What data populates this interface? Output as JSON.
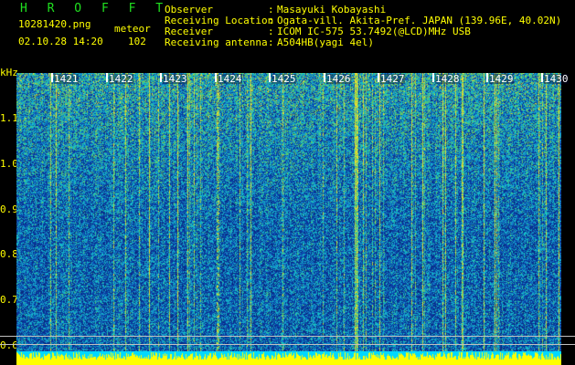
{
  "header": {
    "title": "H R O F F T",
    "filename": "10281420.png",
    "datetime": "02.10.28 14:20",
    "mode": "meteor",
    "count": "102"
  },
  "info": [
    {
      "label": "Observer",
      "value": "Masayuki Kobayashi"
    },
    {
      "label": "Receiving Location",
      "value": "Ogata-vill. Akita-Pref. JAPAN (139.96E, 40.02N)"
    },
    {
      "label": "Receiver",
      "value": "ICOM IC-575 53.7492(@LCD)MHz USB"
    },
    {
      "label": "Receiving antenna",
      "value": "A504HB(yagi 4el)"
    }
  ],
  "colon": ":",
  "yaxis": {
    "unit": "kHz",
    "ticks": [
      "1.1",
      "1.0",
      "0.9",
      "0.8",
      "0.7",
      "0.6"
    ]
  },
  "xaxis": {
    "ticks": [
      "1421",
      "1422",
      "1423",
      "1424",
      "1425",
      "1426",
      "1427",
      "1428",
      "1429",
      "1430"
    ]
  },
  "colors": {
    "spectrum_low": "#0b2a80",
    "spectrum_mid": "#1a8fd6",
    "spectrum_high": "#40d080",
    "spectrum_peak": "#f0e040",
    "baseband": "#ffff00",
    "baseband_alt": "#00d8ff",
    "label_yellow": "#ffff00",
    "title_green": "#20e020"
  }
}
